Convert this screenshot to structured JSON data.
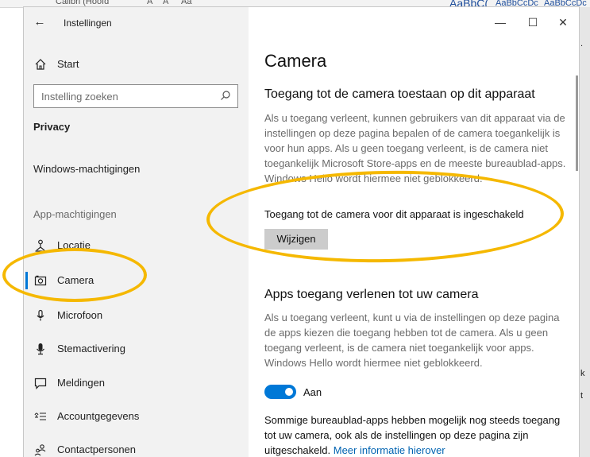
{
  "background_app": {
    "ribbon_font": "Calibri (Hoofd",
    "ribbon_glyphs": [
      "A",
      "A",
      "Aa"
    ],
    "style_sample_1": "AaBbC(",
    "style_sample_2": "AaBbCcDc",
    "style_sample_3": "AaBbCcDc"
  },
  "window": {
    "title": "Instellingen",
    "back_icon": "back-arrow-icon",
    "minimize": "—",
    "maximize": "☐",
    "close": "✕"
  },
  "sidebar": {
    "home_label": "Start",
    "search_placeholder": "Instelling zoeken",
    "category": "Privacy",
    "windows_permissions": "Windows-machtigingen",
    "app_permissions": "App-machtigingen",
    "items": [
      {
        "label": "Locatie",
        "icon": "location-icon"
      },
      {
        "label": "Camera",
        "icon": "camera-icon",
        "selected": true
      },
      {
        "label": "Microfoon",
        "icon": "microphone-icon"
      },
      {
        "label": "Stemactivering",
        "icon": "voice-activation-icon"
      },
      {
        "label": "Meldingen",
        "icon": "notifications-icon"
      },
      {
        "label": "Accountgegevens",
        "icon": "account-info-icon"
      },
      {
        "label": "Contactpersonen",
        "icon": "contacts-icon"
      }
    ]
  },
  "content": {
    "page_title": "Camera",
    "section1": {
      "heading": "Toegang tot de camera toestaan op dit apparaat",
      "description": "Als u toegang verleent, kunnen gebruikers van dit apparaat via de instellingen op deze pagina bepalen of de camera toegankelijk is voor hun apps. Als u geen toegang verleent, is de camera niet toegankelijk Microsoft Store-apps en de meeste bureaublad-apps. Windows Hello wordt hiermee niet geblokkeerd.",
      "status": "Toegang tot de camera voor dit apparaat is ingeschakeld",
      "button": "Wijzigen"
    },
    "section2": {
      "heading": "Apps toegang verlenen tot uw camera",
      "description": "Als u toegang verleent, kunt u via de instellingen op deze pagina de apps kiezen die toegang hebben tot de camera. Als u geen toegang verleent, is de camera niet toegankelijk voor apps. Windows Hello wordt hiermee niet geblokkeerd.",
      "toggle_state": true,
      "toggle_label": "Aan",
      "note": "Sommige bureaublad-apps hebben mogelijk nog steeds toegang tot uw camera, ook als de instellingen op deze pagina zijn uitgeschakeld.",
      "link": "Meer informatie hierover"
    }
  },
  "annotation_color": "#f5b800",
  "accent_color": "#0078d7"
}
